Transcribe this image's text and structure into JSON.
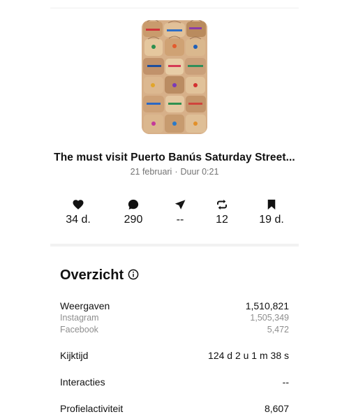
{
  "reel": {
    "title": "The must visit Puerto Banús Saturday Street...",
    "date": "21 februari",
    "separator": "·",
    "duration": "Duur 0:21"
  },
  "stats": [
    {
      "icon": "heart-icon",
      "value": "34 d."
    },
    {
      "icon": "comment-icon",
      "value": "290"
    },
    {
      "icon": "share-icon",
      "value": "--"
    },
    {
      "icon": "repost-icon",
      "value": "12"
    },
    {
      "icon": "bookmark-icon",
      "value": "19 d."
    }
  ],
  "overview": {
    "title": "Overzicht",
    "views": {
      "label": "Weergaven",
      "value": "1,510,821",
      "instagram_label": "Instagram",
      "instagram_value": "1,505,349",
      "facebook_label": "Facebook",
      "facebook_value": "5,472"
    },
    "watch_time": {
      "label": "Kijktijd",
      "value": "124 d 2 u 1 m 38 s"
    },
    "interactions": {
      "label": "Interacties",
      "value": "--"
    },
    "profile_activity": {
      "label": "Profielactiviteit",
      "value": "8,607"
    }
  },
  "colors": {
    "text_primary": "#111111",
    "text_secondary": "#737373",
    "text_tertiary": "#8e8e8e",
    "divider": "#f2f2f2"
  }
}
